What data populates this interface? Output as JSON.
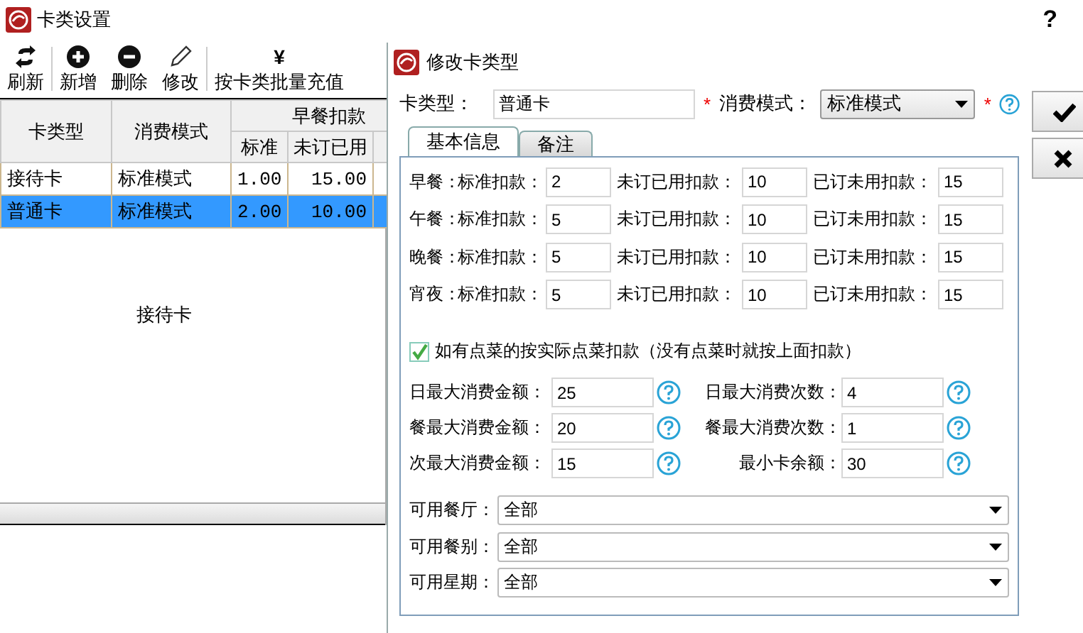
{
  "window": {
    "title": "卡类设置",
    "help": "?"
  },
  "toolbar": [
    {
      "kind": "refresh",
      "label": "刷新"
    },
    {
      "kind": "add",
      "label": "新增"
    },
    {
      "kind": "remove",
      "label": "删除"
    },
    {
      "kind": "edit",
      "label": "修改"
    },
    {
      "kind": "yen",
      "label": "按卡类批量充值",
      "icon_text": "¥"
    }
  ],
  "table": {
    "columns": [
      "卡类型",
      "消费模式"
    ],
    "group": "早餐扣款",
    "subcolumns": [
      "标准",
      "未订已用"
    ],
    "rows": [
      {
        "cells": [
          "接待卡",
          "标准模式",
          "1.00",
          "15.00"
        ],
        "selected": false
      },
      {
        "cells": [
          "普通卡",
          "标准模式",
          "2.00",
          "10.00"
        ],
        "selected": true
      }
    ]
  },
  "detail_label": "接待卡",
  "dialog": {
    "title": "修改卡类型",
    "card_type_label": "卡类型：",
    "card_type": "普通卡",
    "required_mark": "*",
    "mode_label": "消费模式：",
    "mode": "标准模式",
    "tabs": [
      {
        "label": "基本信息",
        "selected": true
      },
      {
        "label": "备注",
        "selected": false
      }
    ],
    "meals": [
      {
        "name": "早餐：",
        "fields": [
          {
            "label": "标准扣款：",
            "value": "2"
          },
          {
            "label": "未订已用扣款：",
            "value": "10"
          },
          {
            "label": "已订未用扣款：",
            "value": "15"
          }
        ]
      },
      {
        "name": "午餐：",
        "fields": [
          {
            "label": "标准扣款：",
            "value": "5"
          },
          {
            "label": "未订已用扣款：",
            "value": "10"
          },
          {
            "label": "已订未用扣款：",
            "value": "15"
          }
        ]
      },
      {
        "name": "晚餐：",
        "fields": [
          {
            "label": "标准扣款：",
            "value": "5"
          },
          {
            "label": "未订已用扣款：",
            "value": "10"
          },
          {
            "label": "已订未用扣款：",
            "value": "15"
          }
        ]
      },
      {
        "name": "宵夜：",
        "fields": [
          {
            "label": "标准扣款：",
            "value": "5"
          },
          {
            "label": "未订已用扣款：",
            "value": "10"
          },
          {
            "label": "已订未用扣款：",
            "value": "15"
          }
        ]
      }
    ],
    "order_option": {
      "label": "如有点菜的按实际点菜扣款（没有点菜时就按上面扣款）",
      "checked": true
    },
    "limits": [
      {
        "label": "日最大消费金额：",
        "value": "25"
      },
      {
        "label": "日最大消费次数：",
        "value": "4"
      },
      {
        "label": "餐最大消费金额：",
        "value": "20"
      },
      {
        "label": "餐最大消费次数：",
        "value": "1"
      },
      {
        "label": "次最大消费金额：",
        "value": "15"
      },
      {
        "label": "最小卡余额：",
        "value": "30"
      }
    ],
    "selects": [
      {
        "label": "可用餐厅：",
        "value": "全部"
      },
      {
        "label": "可用餐别：",
        "value": "全部"
      },
      {
        "label": "可用星期：",
        "value": "全部"
      }
    ]
  }
}
